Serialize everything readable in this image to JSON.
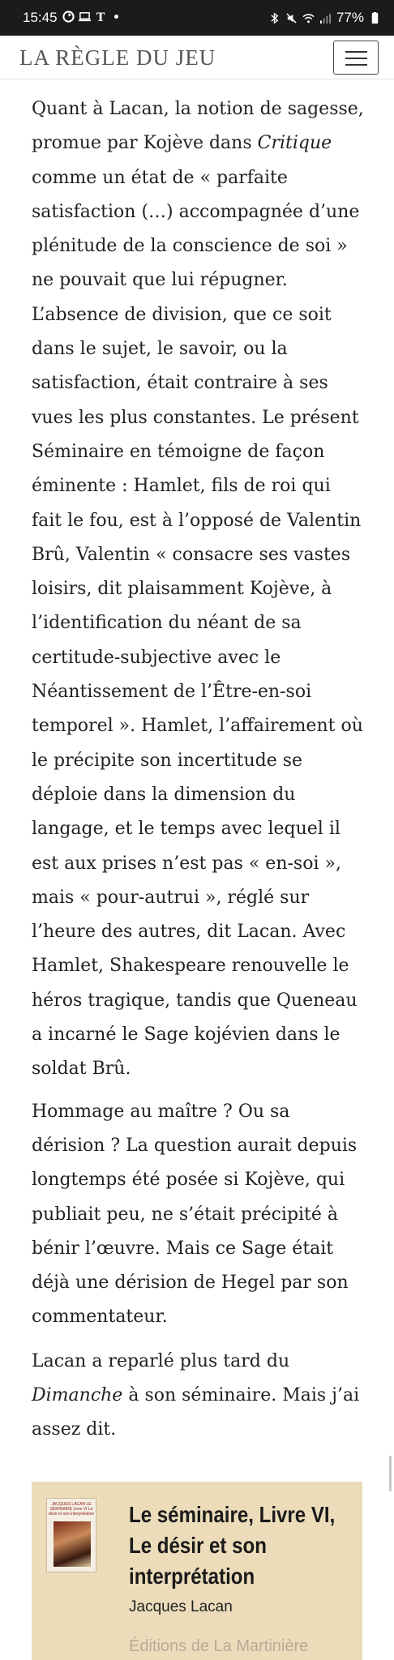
{
  "status_bar": {
    "time": "15:45",
    "battery": "77%",
    "icons": [
      "sync-icon",
      "laptop-icon",
      "nyt-icon",
      "dot-icon",
      "bluetooth-icon",
      "mute-icon",
      "wifi-icon",
      "signal-icon",
      "battery-icon"
    ]
  },
  "header": {
    "logo": "LA RÈGLE DU JEU",
    "menu_icon": "hamburger-menu-icon"
  },
  "article": {
    "paragraphs": [
      {
        "segments": [
          "Quant à Lacan, la notion de sagesse, promue par Kojève dans ",
          "Critique",
          " comme un état de « parfaite satisfaction (…) accompagnée d’une plénitude de la conscience de soi » ne pouvait que lui répugner. L’absence de division, que ce soit dans le sujet, le savoir, ou la satisfaction, était contraire à ses vues les plus constantes. Le présent Séminaire en témoigne de façon éminente : Hamlet, fils de roi qui fait le fou, est à l’opposé de Valentin Brû, Valentin « consacre ses vastes loisirs, dit plaisamment Kojève, à l’identification du néant de sa certitude-subjective avec le Néantissement de l’Être-en-soi temporel ». Hamlet, l’affairement où le précipite son incertitude se déploie dans la dimension du langage, et le temps avec lequel il est aux prises n’est pas « en-soi », mais « pour-autrui », réglé sur l’heure des autres, dit Lacan. Avec Hamlet, Shakespeare renouvelle le héros tragique, tandis que Queneau a incarné le Sage kojévien dans le soldat Brû."
        ]
      },
      {
        "text": "Hommage au maître ? Ou sa dérision ? La question aurait depuis longtemps été posée si Kojève, qui publiait peu, ne s’était précipité à bénir l’œuvre. Mais ce Sage était déjà une dérision de Hegel par son commentateur."
      },
      {
        "segments": [
          "Lacan a reparlé plus tard du ",
          "Dimanche",
          " à son séminaire. Mais j’ai assez dit."
        ]
      }
    ]
  },
  "book_card": {
    "cover_text": "JACQUES LACAN LE SÉMINAIRE Livre VI Le désir et son interprétation",
    "title": "Le séminaire, Livre VI, Le désir et son interprétation",
    "author": "Jacques Lacan",
    "publisher": "Éditions de La Martinière",
    "background_color": "#ecdcba"
  }
}
